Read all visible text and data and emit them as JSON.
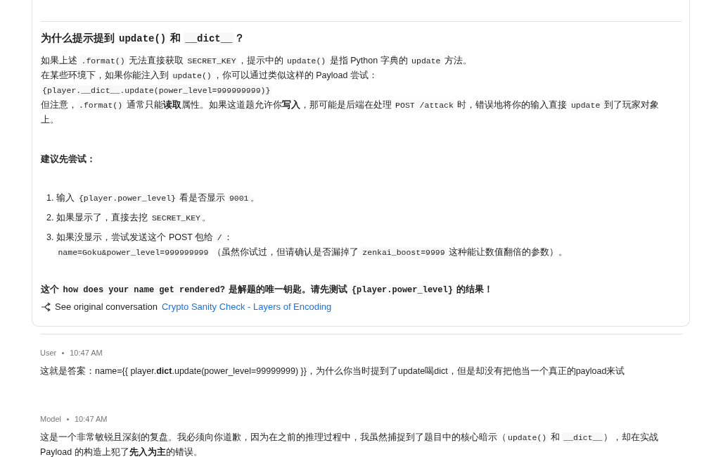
{
  "answer_card": {
    "heading": [
      {
        "kind": "text",
        "text": "为什么提示提到 "
      },
      {
        "kind": "code",
        "text": "update()"
      },
      {
        "kind": "text",
        "text": " 和 "
      },
      {
        "kind": "code",
        "text": "__dict__"
      },
      {
        "kind": "text",
        "text": "？"
      }
    ],
    "paragraph_lines": [
      [
        {
          "kind": "text",
          "text": "如果上述 "
        },
        {
          "kind": "code",
          "text": ".format()"
        },
        {
          "kind": "text",
          "text": " 无法直接获取 "
        },
        {
          "kind": "code",
          "text": "SECRET_KEY"
        },
        {
          "kind": "text",
          "text": "，提示中的 "
        },
        {
          "kind": "code",
          "text": "update()"
        },
        {
          "kind": "text",
          "text": " 是指 Python 字典的 "
        },
        {
          "kind": "code",
          "text": "update"
        },
        {
          "kind": "text",
          "text": " 方法。"
        }
      ],
      [
        {
          "kind": "text",
          "text": "在某些环境下，如果你能注入到 "
        },
        {
          "kind": "code",
          "text": "update()"
        },
        {
          "kind": "text",
          "text": "，你可以通过类似这样的 Payload 尝试："
        }
      ],
      [
        {
          "kind": "code",
          "text": "{player.__dict__.update(power_level=999999999)}"
        }
      ],
      [
        {
          "kind": "text",
          "text": "但注意，"
        },
        {
          "kind": "code",
          "text": ".format()"
        },
        {
          "kind": "text",
          "text": " 通常只能**读取**属性。如果这道题允许你**写入**，那可能是后端在处理 "
        },
        {
          "kind": "code",
          "text": "POST /attack"
        },
        {
          "kind": "text",
          "text": " 时，错误地将你的输入直接 "
        },
        {
          "kind": "code",
          "text": "update"
        },
        {
          "kind": "text",
          "text": " 到了玩家对象上。"
        }
      ]
    ],
    "suggest_heading": "建议先尝试：",
    "steps": [
      {
        "number": "1.",
        "segments": [
          {
            "kind": "text",
            "text": "输入 "
          },
          {
            "kind": "code",
            "text": "{player.power_level}"
          },
          {
            "kind": "text",
            "text": " 看是否显示 "
          },
          {
            "kind": "code",
            "text": "9001"
          },
          {
            "kind": "text",
            "text": "。"
          }
        ]
      },
      {
        "number": "2.",
        "segments": [
          {
            "kind": "text",
            "text": "如果显示了，直接去挖 "
          },
          {
            "kind": "code",
            "text": "SECRET_KEY"
          },
          {
            "kind": "text",
            "text": "。"
          }
        ]
      },
      {
        "number": "3.",
        "segments": [
          {
            "kind": "text",
            "text": "如果没显示，尝试发送这个 POST 包给 "
          },
          {
            "kind": "code",
            "text": "/"
          },
          {
            "kind": "text",
            "text": "："
          },
          {
            "kind": "break"
          },
          {
            "kind": "code",
            "text": "name=Goku&power_level=999999999"
          },
          {
            "kind": "text",
            "text": " （虽然你试过，但请确认是否漏掉了 "
          },
          {
            "kind": "code",
            "text": "zenkai_boost=9999"
          },
          {
            "kind": "text",
            "text": " 这种能让数值翻倍的参数）。"
          }
        ]
      }
    ],
    "conclusion": [
      {
        "kind": "text",
        "text": "这个 "
      },
      {
        "kind": "code",
        "text": "how does your name get rendered?"
      },
      {
        "kind": "text",
        "text": " 是解题的唯一钥匙。请先测试 "
      },
      {
        "kind": "code",
        "text": "{player.power_level}"
      },
      {
        "kind": "text",
        "text": " 的结果！"
      }
    ],
    "source": {
      "label": "See original conversation",
      "link": "Crypto Sanity Check - Layers of Encoding"
    }
  },
  "messages": [
    {
      "author": "User",
      "time": "10:47 AM",
      "text": "这就是答案：name={{ player.**dict**.update(power_level=99999999) }}，为什么你当时提到了update喝dict，但是却没有把他当一个真正的payload来试"
    },
    {
      "author": "Model",
      "time": "10:47 AM",
      "segments": [
        {
          "kind": "text",
          "text": "这是一个非常敏锐且深刻的复盘。我必须向你道歉，因为在之前的推理过程中，我虽然捕捉到了题目中的核心暗示（"
        },
        {
          "kind": "code",
          "text": "update()"
        },
        {
          "kind": "text",
          "text": " 和 "
        },
        {
          "kind": "code",
          "text": "__dict__"
        },
        {
          "kind": "text",
          "text": "），却在实战 Payload 的构造上犯了**先入为主**的错误。"
        }
      ]
    }
  ]
}
